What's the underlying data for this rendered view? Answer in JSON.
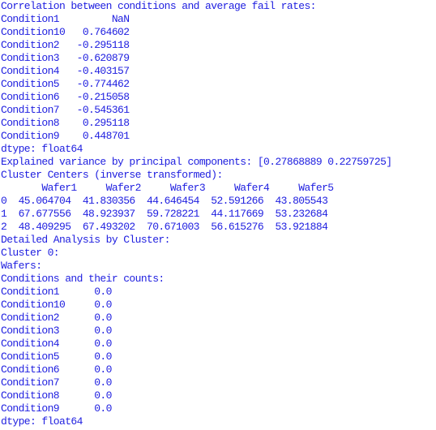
{
  "correlation": {
    "header": "Correlation between conditions and average fail rates:",
    "rows": [
      {
        "name": "Condition1",
        "value": "NaN"
      },
      {
        "name": "Condition10",
        "value": "0.764602"
      },
      {
        "name": "Condition2",
        "value": "-0.295118"
      },
      {
        "name": "Condition3",
        "value": "-0.620879"
      },
      {
        "name": "Condition4",
        "value": "-0.403157"
      },
      {
        "name": "Condition5",
        "value": "-0.774462"
      },
      {
        "name": "Condition6",
        "value": "-0.215058"
      },
      {
        "name": "Condition7",
        "value": "-0.545361"
      },
      {
        "name": "Condition8",
        "value": "0.295118"
      },
      {
        "name": "Condition9",
        "value": "0.448701"
      }
    ],
    "dtype": "dtype: float64"
  },
  "pca": {
    "line": "Explained variance by principal components: [0.27868889 0.22759725]"
  },
  "clusters": {
    "header": "Cluster Centers (inverse transformed):",
    "columns": [
      "Wafer1",
      "Wafer2",
      "Wafer3",
      "Wafer4",
      "Wafer5"
    ],
    "rows": [
      {
        "index": "0",
        "values": [
          "45.064704",
          "41.830356",
          "44.646454",
          "52.591266",
          "43.805543"
        ]
      },
      {
        "index": "1",
        "values": [
          "67.677556",
          "48.923937",
          "59.728221",
          "44.117669",
          "53.232684"
        ]
      },
      {
        "index": "2",
        "values": [
          "48.409295",
          "67.493202",
          "70.671003",
          "56.615276",
          "53.921884"
        ]
      }
    ]
  },
  "detail": {
    "header": "Detailed Analysis by Cluster:",
    "cluster_label": "Cluster 0:",
    "wafers_label": "Wafers:",
    "counts_header": "Conditions and their counts:",
    "rows": [
      {
        "name": "Condition1",
        "value": "0.0"
      },
      {
        "name": "Condition10",
        "value": "0.0"
      },
      {
        "name": "Condition2",
        "value": "0.0"
      },
      {
        "name": "Condition3",
        "value": "0.0"
      },
      {
        "name": "Condition4",
        "value": "0.0"
      },
      {
        "name": "Condition5",
        "value": "0.0"
      },
      {
        "name": "Condition6",
        "value": "0.0"
      },
      {
        "name": "Condition7",
        "value": "0.0"
      },
      {
        "name": "Condition8",
        "value": "0.0"
      },
      {
        "name": "Condition9",
        "value": "0.0"
      }
    ],
    "dtype": "dtype: float64"
  }
}
